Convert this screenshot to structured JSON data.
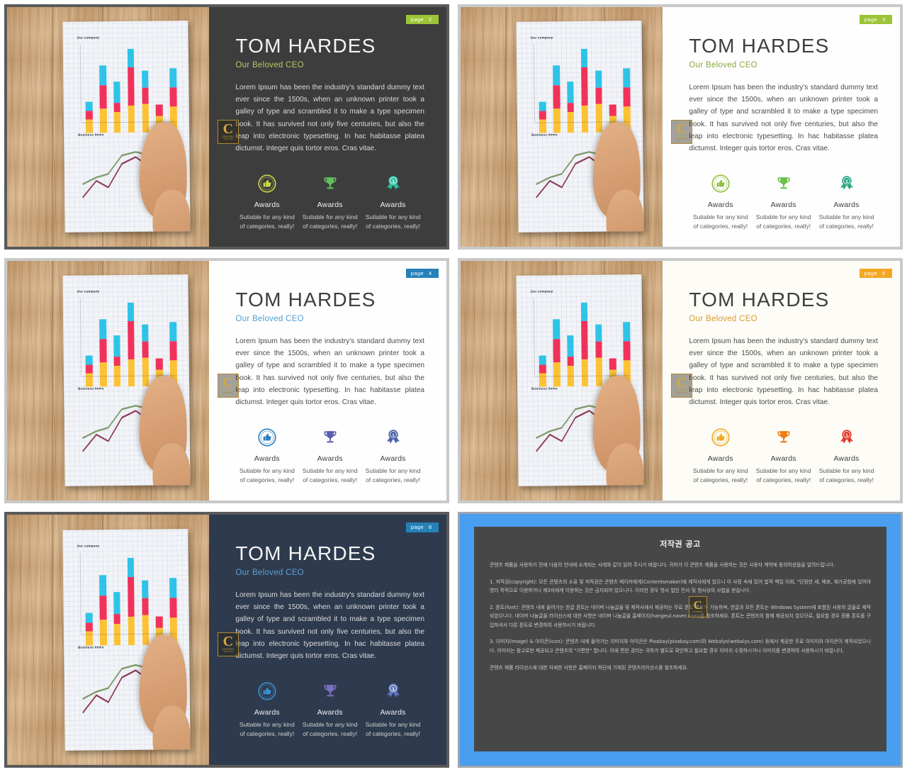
{
  "deck": {
    "person_name": "TOM HARDES",
    "role": "Our Beloved CEO",
    "body": "Lorem Ipsum has been the industry's standard dummy text ever since the 1500s, when an unknown printer took a galley of type and scrambled it to make a type specimen book. It has survived not only five centuries, but also the leap into electronic typesetting. In hac habitasse platea dictumst. Integer quis tortor eros. Cras vitae.",
    "award_title": "Awards",
    "award_desc": "Sutiable for any kind of categories, really!",
    "page_label": "page",
    "watermark": {
      "letter": "C",
      "line1": "CONTENT",
      "line2": "TEMPLATE"
    },
    "photo": {
      "chart_title_1": "Our company",
      "chart_title_2": "Business items"
    }
  },
  "slides": [
    {
      "page_number": "2",
      "badge_color": "#9bc437",
      "theme": "dark",
      "frame_color": "#5a5a5a",
      "name_color": "#f4f4f4",
      "role_color": "#b8c96a",
      "icon_colors": [
        "#c8d44a",
        "#62c25c",
        "#2fbf9e"
      ]
    },
    {
      "page_number": "3",
      "badge_color": "#9bc437",
      "theme": "white",
      "frame_color": "#c9c9c9",
      "name_color": "#3e3e3e",
      "role_color": "#8aa83c",
      "icon_colors": [
        "#8fbf3f",
        "#6dbe4e",
        "#2fa98a"
      ]
    },
    {
      "page_number": "4",
      "badge_color": "#2681b8",
      "theme": "white",
      "frame_color": "#c9c9c9",
      "name_color": "#3e3e3e",
      "role_color": "#4f9ed4",
      "icon_colors": [
        "#2f7fbd",
        "#5b5fb0",
        "#4a63a8"
      ]
    },
    {
      "page_number": "5",
      "badge_color": "#f5a623",
      "theme": "ivory",
      "frame_color": "#c9c9c9",
      "name_color": "#3e3e3e",
      "role_color": "#d79a2e",
      "icon_colors": [
        "#f3a81f",
        "#ef7d17",
        "#e03a2c"
      ]
    },
    {
      "page_number": "6",
      "badge_color": "#2681b8",
      "theme": "navy",
      "frame_color": "#5a5a5a",
      "name_color": "#f4f4f4",
      "role_color": "#5e9fd4",
      "icon_colors": [
        "#3d8fd0",
        "#7a6fc0",
        "#5f74bd"
      ]
    }
  ],
  "copyright": {
    "title": "저작권 공고",
    "paragraphs": [
      "콘텐츠 제품을 사용하기 전에 다음의 안내에 소개되는 사례와 같이 읽어 주시기 바랍니다. 귀하가 이 콘텐츠 제품을 사용하는 것은 사용자 계약에 동의하셨음을 알려드립니다.",
      "1. 저작권(copyright): 모든 콘텐츠의 소유 및 저작권은 콘텐츠 메이커에게(Contentsmaker)에 제작사에게 있으니 이 사정 속에 있어 법적 책임 이외, \"단정한 세, 배포, 재가공함에 있어야 영리 목적으로 이용하거나 제3자에게 이용하는 것은 금지되어 있으니다. 이러한 경우 형사 법인 민사 및 형사상의 사법을 받습니다.",
      "2. 폰트(font): 콘텐츠 내에 들어가는 한글 폰트는 네이버 나눔글꼴 및 제작사에서 제공하는 무료 폰트 배포가 가능하며, 한글과 모든 폰트는 Windows System에 포함된 사용의 글꼴로 제작되었으니다. 네이버 나눔글꼴 라이선스에 대한 사항은 네이버 나눔글꼴 홈페이지(hangeul.naver.com)를 참조하세요. 폰트는 콘텐츠의 함께 제공되지 않으므로, 필요할 경우 정품 폰트를 구입하셔서 다른 폰트로 변경하여 사용하시기 바랍니다.",
      "3. 이미지(image) & 아이콘(icon): 콘텐츠 내에 들어가는 이미지와 아이콘은 Pixabay(pixabay.com)와 Webalys(webalys.com) 등에서 제공한 무료 이미지와 아이콘이 제작되었으니다. 이미지는 참고로만 제공되고 콘텐츠의 \"가편한\" 합니다. 이에 편한 권리는 귀하가 별도로 확인하고 필요할 경우 이미지 수정하시거나 이미지를 변경하여 사용하시기 바랍니다.",
      "콘텐츠 제품 라이선스에 대한 자세한 사항은 홈페이지 하단에 기재된 콘텐츠라이선스를 참조하세요."
    ],
    "watermark": {
      "letter": "C",
      "line1": "CONTENT"
    }
  }
}
